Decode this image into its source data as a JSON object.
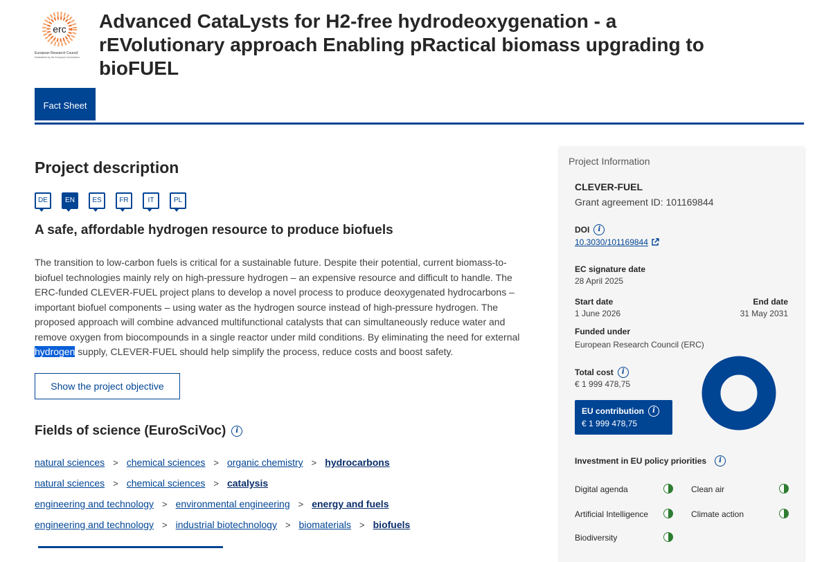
{
  "header": {
    "logo_text": "erc",
    "logo_name": "European Research Council",
    "logo_sub": "Established by the European Commission",
    "title": "Advanced CataLysts for H2-free hydrodeoxygenation - a rEVolutionary approach Enabling pRactical biomass upgrading to bioFUEL"
  },
  "tabs": [
    {
      "label": "Fact Sheet"
    }
  ],
  "main": {
    "section_title": "Project description",
    "languages": [
      "DE",
      "EN",
      "ES",
      "FR",
      "IT",
      "PL"
    ],
    "active_language": "EN",
    "subtitle": "A safe, affordable hydrogen resource to produce biofuels",
    "description_before": "The transition to low-carbon fuels is critical for a sustainable future. Despite their potential, current biomass-to-biofuel technologies mainly rely on high-pressure hydrogen – an expensive resource and difficult to handle. The ERC-funded CLEVER-FUEL project plans to develop a novel process to produce deoxygenated hydrocarbons – important biofuel components – using water as the hydrogen source instead of high-pressure hydrogen. The proposed approach will combine advanced multifunctional catalysts that can simultaneously reduce water and remove oxygen from biocompounds in a single reactor under mild conditions. By eliminating the need for external ",
    "description_highlight": "hydrogen",
    "description_after": " supply, CLEVER-FUEL should help simplify the process, reduce costs and boost safety.",
    "objective_button": "Show the project objective",
    "fields_title": "Fields of science (EuroSciVoc)",
    "fields": [
      [
        "natural sciences",
        "chemical sciences",
        "organic chemistry",
        "hydrocarbons"
      ],
      [
        "natural sciences",
        "chemical sciences",
        "catalysis"
      ],
      [
        "engineering and technology",
        "environmental engineering",
        "energy and fuels"
      ],
      [
        "engineering and technology",
        "industrial biotechnology",
        "biomaterials",
        "biofuels"
      ]
    ]
  },
  "sidebar": {
    "heading": "Project Information",
    "acronym": "CLEVER-FUEL",
    "grant": "Grant agreement ID: 101169844",
    "doi_label": "DOI",
    "doi_value": "10.3030/101169844",
    "signature_label": "EC signature date",
    "signature_value": "28 April 2025",
    "start_label": "Start date",
    "start_value": "1 June 2026",
    "end_label": "End date",
    "end_value": "31 May 2031",
    "funded_label": "Funded under",
    "funded_value": "European Research Council (ERC)",
    "total_cost_label": "Total cost",
    "total_cost_value": "€ 1 999 478,75",
    "eu_contribution_label": "EU contribution",
    "eu_contribution_value": "€ 1 999 478,75",
    "eu_share_percent": 100,
    "policy_title": "Investment in EU policy priorities",
    "policies": [
      "Digital agenda",
      "Clean air",
      "Artificial Intelligence",
      "Climate action",
      "Biodiversity"
    ]
  },
  "colors": {
    "primary": "#004494",
    "highlight": "#0b5fd8",
    "policy_green": "#2e7d32"
  },
  "icons": [
    "info-icon",
    "external-link-icon",
    "chevron-right-icon",
    "half-circle-icon",
    "language-bubble-icon"
  ]
}
